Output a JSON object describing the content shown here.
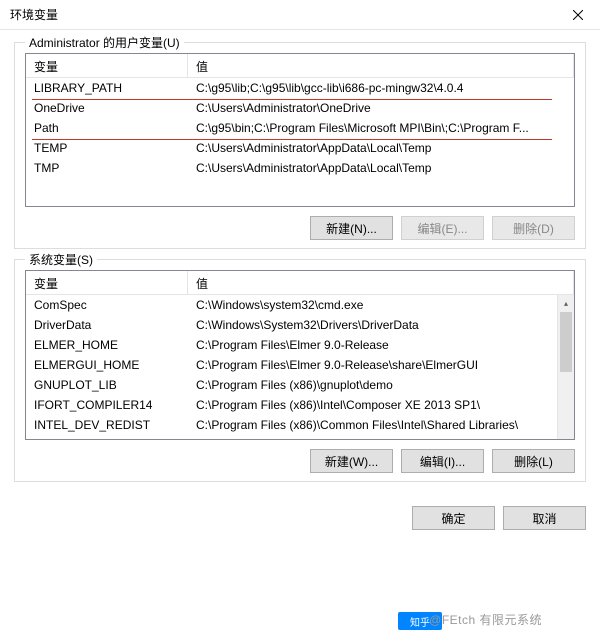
{
  "window": {
    "title": "环境变量"
  },
  "user_section": {
    "label": "Administrator 的用户变量(U)",
    "header_name": "变量",
    "header_value": "值",
    "rows": [
      {
        "name": "LIBRARY_PATH",
        "value": "C:\\g95\\lib;C:\\g95\\lib\\gcc-lib\\i686-pc-mingw32\\4.0.4"
      },
      {
        "name": "OneDrive",
        "value": "C:\\Users\\Administrator\\OneDrive"
      },
      {
        "name": "Path",
        "value": "C:\\g95\\bin;C:\\Program Files\\Microsoft MPI\\Bin\\;C:\\Program F..."
      },
      {
        "name": "TEMP",
        "value": "C:\\Users\\Administrator\\AppData\\Local\\Temp"
      },
      {
        "name": "TMP",
        "value": "C:\\Users\\Administrator\\AppData\\Local\\Temp"
      }
    ],
    "buttons": {
      "new": "新建(N)...",
      "edit": "编辑(E)...",
      "delete": "删除(D)"
    }
  },
  "system_section": {
    "label": "系统变量(S)",
    "header_name": "变量",
    "header_value": "值",
    "rows": [
      {
        "name": "ComSpec",
        "value": "C:\\Windows\\system32\\cmd.exe"
      },
      {
        "name": "DriverData",
        "value": "C:\\Windows\\System32\\Drivers\\DriverData"
      },
      {
        "name": "ELMER_HOME",
        "value": "C:\\Program Files\\Elmer 9.0-Release"
      },
      {
        "name": "ELMERGUI_HOME",
        "value": "C:\\Program Files\\Elmer 9.0-Release\\share\\ElmerGUI"
      },
      {
        "name": "GNUPLOT_LIB",
        "value": "C:\\Program Files (x86)\\gnuplot\\demo"
      },
      {
        "name": "IFORT_COMPILER14",
        "value": "C:\\Program Files (x86)\\Intel\\Composer XE 2013 SP1\\"
      },
      {
        "name": "INTEL_DEV_REDIST",
        "value": "C:\\Program Files (x86)\\Common Files\\Intel\\Shared Libraries\\"
      }
    ],
    "buttons": {
      "new": "新建(W)...",
      "edit": "编辑(I)...",
      "delete": "删除(L)"
    }
  },
  "dialog_buttons": {
    "ok": "确定",
    "cancel": "取消"
  },
  "watermark": {
    "logo": "知乎",
    "text": "@FEtch 有限元系统"
  }
}
